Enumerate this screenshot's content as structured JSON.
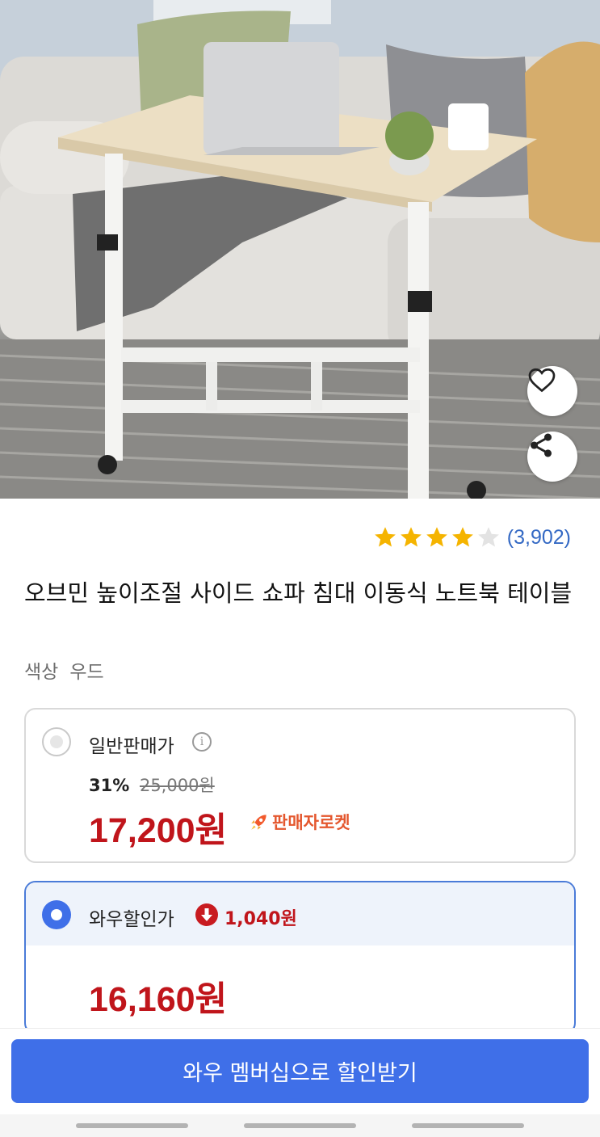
{
  "product": {
    "image_alt": "",
    "rating": 4,
    "rating_max": 5,
    "review_count": "(3,902)",
    "title": "오브민 높이조절 사이드 쇼파 침대 이동식 노트북 테이블",
    "option_name": "색상",
    "option_value": "우드",
    "icons": {
      "favorite": "heart-icon",
      "share": "share-icon"
    }
  },
  "regular_price": {
    "label": "일반판매가",
    "discount_rate": "31%",
    "original_price": "25,000원",
    "price": "17,200원",
    "badge": "판매자로켓"
  },
  "wow_price": {
    "label": "와우할인가",
    "extra_discount": "1,040원",
    "price": "16,160원"
  },
  "cta": {
    "label": "와우 멤버십으로 할인받기"
  },
  "colors": {
    "accent": "#3f6fe8",
    "price": "#c0151b",
    "star": "#f5b400",
    "link": "#3469c4"
  }
}
